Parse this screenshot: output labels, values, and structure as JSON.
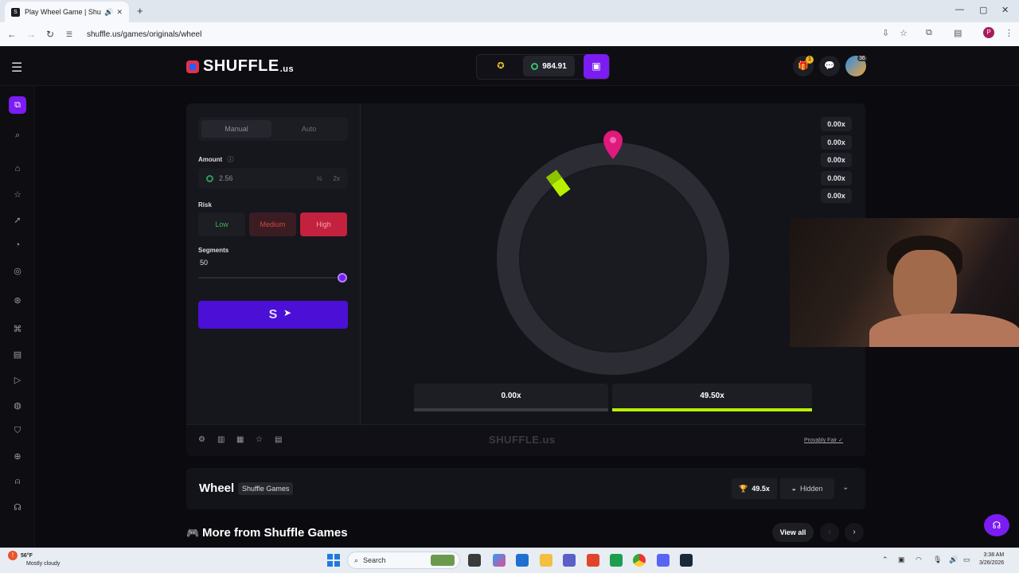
{
  "browser": {
    "tab_title": "Play Wheel Game | Shuffle.us",
    "url": "shuffle.us/games/originals/wheel",
    "profile_initial": "P"
  },
  "header": {
    "logo_text": "SHUFFLE",
    "logo_tld": ".us",
    "balance": "984.91",
    "notification_count": "1",
    "avatar_level": "36"
  },
  "controls": {
    "tabs": [
      "Manual",
      "Auto"
    ],
    "amount_label": "Amount",
    "amount_value": "2.56",
    "half_label": "½",
    "double_label": "2x",
    "risk_label": "Risk",
    "risk_options": [
      "Low",
      "Medium",
      "High"
    ],
    "risk_selected": "High",
    "segments_label": "Segments",
    "segments_value": "50",
    "segments_slider_fraction": 1.0
  },
  "wheel": {
    "history": [
      "0.00x",
      "0.00x",
      "0.00x",
      "0.00x",
      "0.00x"
    ],
    "payouts": [
      "0.00x",
      "49.50x"
    ],
    "colors": {
      "zero": "#3a3a44",
      "win": "#b8f000",
      "pointer": "#e0197d",
      "accent": "#7b1cf2"
    }
  },
  "game_footer": {
    "logo": "SHUFFLE.us",
    "provably_fair": "Provably Fair"
  },
  "info": {
    "game_name": "Wheel",
    "provider": "Shuffle Games",
    "max_win": "49.5x",
    "visibility": "Hidden",
    "more_title": "More from Shuffle Games",
    "view_all": "View all"
  },
  "taskbar": {
    "temperature": "56°F",
    "weather": "Mostly cloudy",
    "search_placeholder": "Search",
    "time": "3:38 AM",
    "date": "3/26/2026"
  }
}
